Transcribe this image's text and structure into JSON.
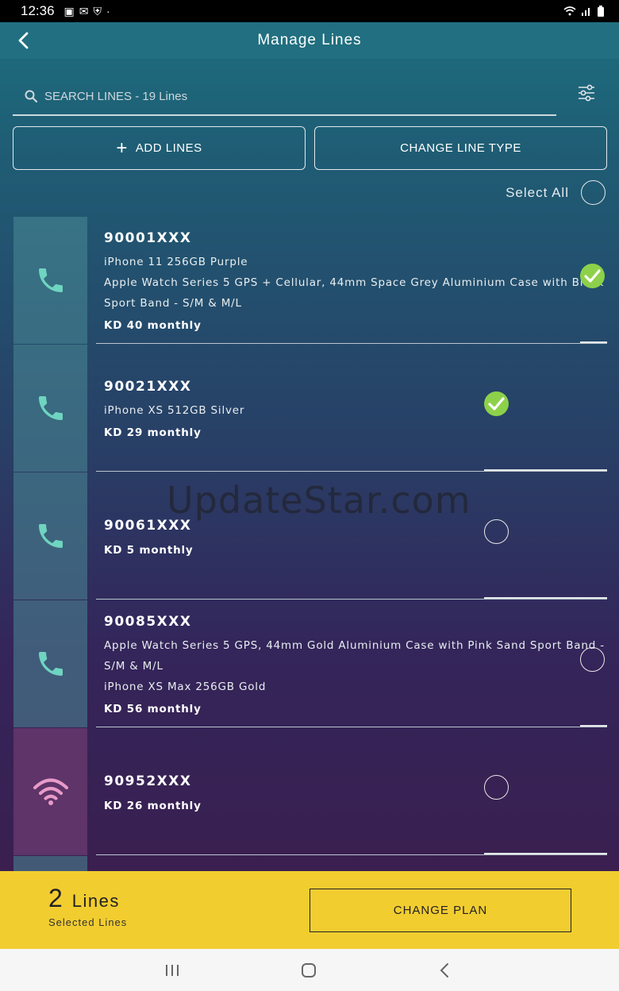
{
  "status_bar": {
    "time": "12:36"
  },
  "header": {
    "title": "Manage Lines"
  },
  "search": {
    "placeholder": "SEARCH LINES - 19 Lines"
  },
  "actions": {
    "add_lines": "ADD LINES",
    "change_line_type": "CHANGE LINE TYPE"
  },
  "select_all": {
    "label": "Select All",
    "checked": false
  },
  "lines": [
    {
      "number": "90001XXX",
      "type": "voice",
      "devices": [
        "iPhone 11 256GB Purple",
        "Apple Watch Series 5 GPS + Cellular, 44mm Space Grey Aluminium Case with Black",
        "Sport Band - S/M & M/L"
      ],
      "price": "KD 40 monthly",
      "selected": true
    },
    {
      "number": "90021XXX",
      "type": "voice",
      "devices": [
        "iPhone XS 512GB Silver"
      ],
      "price": "KD 29 monthly",
      "selected": true
    },
    {
      "number": "90061XXX",
      "type": "voice",
      "devices": [],
      "price": "KD 5 monthly",
      "selected": false
    },
    {
      "number": "90085XXX",
      "type": "voice",
      "devices": [
        "Apple Watch Series 5 GPS, 44mm Gold Aluminium Case with Pink Sand Sport Band -",
        "S/M & M/L",
        "iPhone XS Max 256GB Gold"
      ],
      "price": "KD 56 monthly",
      "selected": false
    },
    {
      "number": "90952XXX",
      "type": "data",
      "devices": [],
      "price": "KD 26 monthly",
      "selected": false
    }
  ],
  "footer": {
    "count": "2",
    "count_unit": "Lines",
    "sublabel": "Selected Lines",
    "change_plan": "CHANGE PLAN"
  },
  "watermark": "UpdateStar.com",
  "colors": {
    "accent_yellow": "#f2cd30",
    "check_green": "#8dd14a",
    "phone_icon": "#6fd4c0",
    "wifi_icon": "#e89bc8"
  },
  "icons": {
    "voice": "phone-icon",
    "data": "wifi-icon",
    "back": "back-arrow-icon",
    "filter": "filter-sliders-icon",
    "search": "search-icon",
    "add": "plus-icon"
  }
}
